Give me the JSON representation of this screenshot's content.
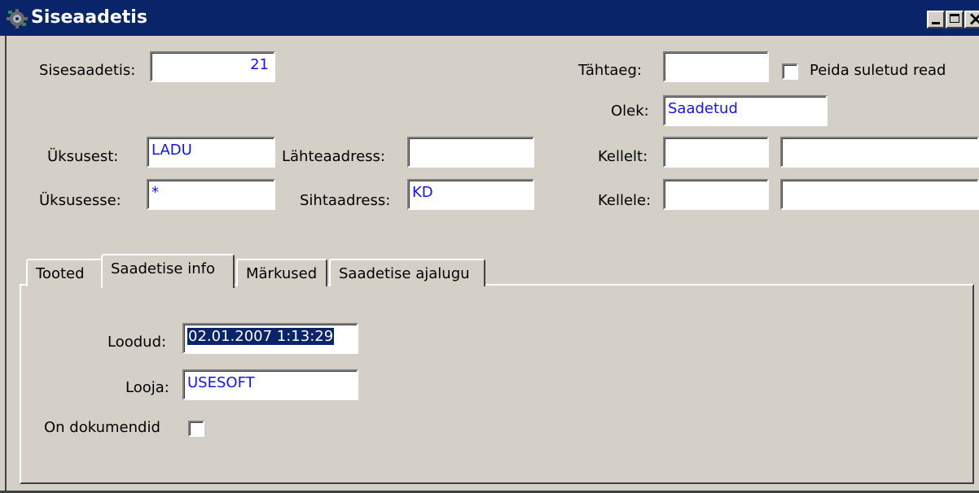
{
  "window": {
    "title": "Siseaadetis",
    "icon": "app-gear-icon",
    "controls": [
      "minimize",
      "maximize",
      "close"
    ]
  },
  "header": {
    "sisesaadetis_label": "Sisesaadetis:",
    "sisesaadetis_value": "21",
    "tahtaeg_label": "Tähtaeg:",
    "tahtaeg_value": "",
    "peida_label": "Peida suletud read",
    "peida_checked": false,
    "olek_label": "Olek:",
    "olek_value": "Saadetud",
    "uksusest_label": "Üksusest:",
    "uksusest_value": "LADU",
    "lahteaadress_label": "Lähteaadress:",
    "lahteaadress_value": "",
    "kellelt_label": "Kellelt:",
    "kellelt_code": "",
    "kellelt_name": "",
    "uksusesse_label": "Üksusesse:",
    "uksusesse_value": "*",
    "sihtaadress_label": "Sihtaadress:",
    "sihtaadress_value": "KD",
    "kellele_label": "Kellele:",
    "kellele_code": "",
    "kellele_name": ""
  },
  "tabs": [
    {
      "label": "Tooted",
      "active": false
    },
    {
      "label": "Saadetise info",
      "active": true
    },
    {
      "label": "Märkused",
      "active": false
    },
    {
      "label": "Saadetise ajalugu",
      "active": false
    }
  ],
  "info": {
    "loodud_label": "Loodud:",
    "loodud_value": "02.01.2007 1:13:29",
    "looja_label": "Looja:",
    "looja_value": "USESOFT",
    "on_dokumendid_label": "On dokumendid",
    "on_dokumendid_checked": false
  },
  "colors": {
    "titlebar": "#0a246a",
    "window_bg": "#d4d0c8",
    "field_text": "#1414ff",
    "selection": "#0a246a"
  }
}
